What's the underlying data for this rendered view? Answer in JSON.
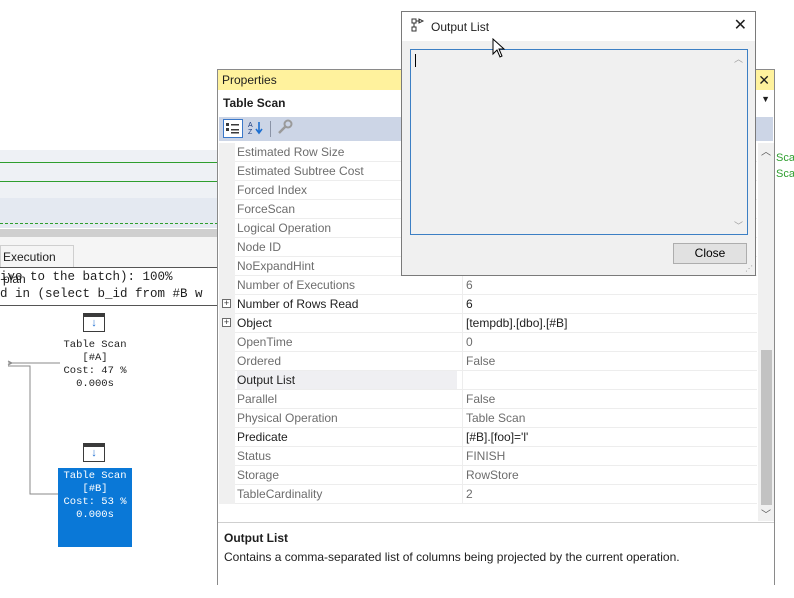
{
  "background": {
    "exec_tab_label": "Execution plan",
    "query_line1": "ive to the batch): 100%",
    "query_line2": "d in (select b_id from #B w",
    "node_a": {
      "title": "Table Scan",
      "object": "[#A]",
      "cost": "Cost: 47 %",
      "time": "0.000s"
    },
    "node_b": {
      "title": "Table Scan",
      "object": "[#B]",
      "cost": "Cost: 53 %",
      "time": "0.000s"
    },
    "right_edge_1": "Sca",
    "right_edge_2": "Sca",
    "colors": {
      "grid_line": "#2e9e2e",
      "selected_node": "#0a78d7"
    }
  },
  "properties": {
    "title": "Properties",
    "object_name": "Table Scan",
    "rows": [
      {
        "name": "Estimated Row Size",
        "value": "",
        "bold": false,
        "expand": false
      },
      {
        "name": "Estimated Subtree Cost",
        "value": "",
        "bold": false,
        "expand": false
      },
      {
        "name": "Forced Index",
        "value": "",
        "bold": false,
        "expand": false
      },
      {
        "name": "ForceScan",
        "value": "",
        "bold": false,
        "expand": false
      },
      {
        "name": "Logical Operation",
        "value": "",
        "bold": false,
        "expand": false
      },
      {
        "name": "Node ID",
        "value": "",
        "bold": false,
        "expand": false
      },
      {
        "name": "NoExpandHint",
        "value": "",
        "bold": false,
        "expand": false
      },
      {
        "name": "Number of Executions",
        "value": "6",
        "bold": false,
        "expand": false
      },
      {
        "name": "Number of Rows Read",
        "value": "6",
        "bold": true,
        "expand": true
      },
      {
        "name": "Object",
        "value": "[tempdb].[dbo].[#B]",
        "bold": true,
        "expand": true
      },
      {
        "name": "OpenTime",
        "value": "0",
        "bold": false,
        "expand": false
      },
      {
        "name": "Ordered",
        "value": "False",
        "bold": false,
        "expand": false
      },
      {
        "name": "Output List",
        "value": "",
        "bold": true,
        "expand": false,
        "selected": true
      },
      {
        "name": "Parallel",
        "value": "False",
        "bold": false,
        "expand": false
      },
      {
        "name": "Physical Operation",
        "value": "Table Scan",
        "bold": false,
        "expand": false
      },
      {
        "name": "Predicate",
        "value": "[#B].[foo]='l'",
        "bold": true,
        "expand": false
      },
      {
        "name": "Status",
        "value": "FINISH",
        "bold": false,
        "expand": false
      },
      {
        "name": "Storage",
        "value": "RowStore",
        "bold": false,
        "expand": false
      },
      {
        "name": "TableCardinality",
        "value": "2",
        "bold": false,
        "expand": false
      }
    ],
    "description_title": "Output List",
    "description_text": "Contains a comma-separated list of columns being projected by the current operation.",
    "icons": [
      "categorized-icon",
      "alphabetical-icon",
      "property-pages-icon"
    ]
  },
  "dialog": {
    "title": "Output List",
    "text_value": "",
    "close_label": "Close"
  }
}
